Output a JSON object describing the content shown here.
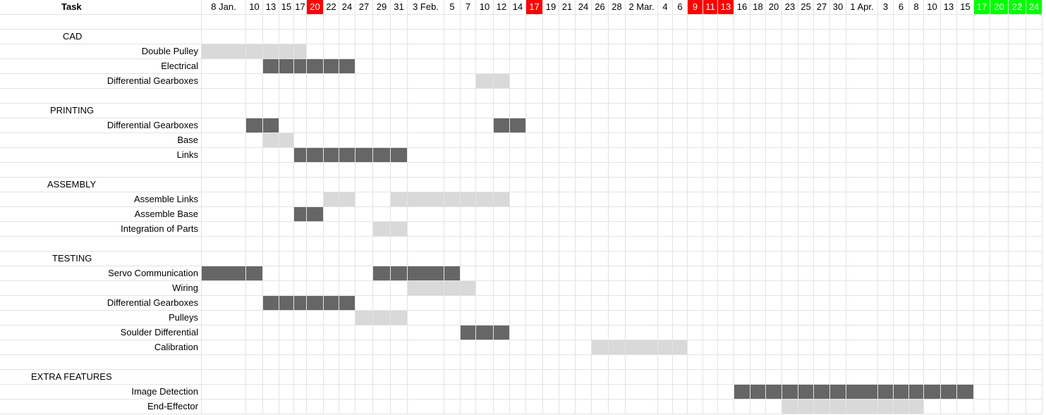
{
  "sheet": {
    "task_header": "Task",
    "dates": [
      "8 Jan.",
      "10",
      "13",
      "15",
      "17",
      "20",
      "22",
      "24",
      "27",
      "29",
      "31",
      "3 Feb.",
      "5",
      "7",
      "10",
      "12",
      "14",
      "17",
      "19",
      "21",
      "24",
      "26",
      "28",
      "2 Mar.",
      "4",
      "6",
      "9",
      "11",
      "13",
      "16",
      "18",
      "20",
      "23",
      "25",
      "27",
      "30",
      "1 Apr.",
      "3",
      "6",
      "8",
      "10",
      "13",
      "15",
      "17",
      "20",
      "22",
      "24"
    ],
    "date_highlights": {
      "5": "red",
      "17": "red",
      "26": "red",
      "27": "red",
      "28": "red",
      "43": "green",
      "44": "green",
      "45": "green",
      "46": "green"
    },
    "highlight_colors": {
      "red": "#ff0000",
      "green": "#00ff00"
    },
    "bar_colors": {
      "dark": "#666666",
      "light": "#d9d9d9"
    },
    "rows": [
      {
        "type": "blank"
      },
      {
        "type": "section",
        "label": "CAD"
      },
      {
        "type": "task",
        "label": "Double Pulley",
        "bars": [
          {
            "start": 0,
            "end": 4,
            "shade": "light"
          }
        ]
      },
      {
        "type": "task",
        "label": "Electrical",
        "bars": [
          {
            "start": 2,
            "end": 7,
            "shade": "dark"
          }
        ]
      },
      {
        "type": "task",
        "label": "Differential Gearboxes",
        "bars": [
          {
            "start": 14,
            "end": 15,
            "shade": "light"
          }
        ]
      },
      {
        "type": "blank"
      },
      {
        "type": "section",
        "label": "PRINTING"
      },
      {
        "type": "task",
        "label": "Differential Gearboxes",
        "bars": [
          {
            "start": 1,
            "end": 2,
            "shade": "dark"
          },
          {
            "start": 15,
            "end": 16,
            "shade": "dark"
          }
        ]
      },
      {
        "type": "task",
        "label": "Base",
        "bars": [
          {
            "start": 2,
            "end": 3,
            "shade": "light"
          }
        ]
      },
      {
        "type": "task",
        "label": "Links",
        "bars": [
          {
            "start": 4,
            "end": 10,
            "shade": "dark"
          }
        ]
      },
      {
        "type": "blank"
      },
      {
        "type": "section",
        "label": "ASSEMBLY"
      },
      {
        "type": "task",
        "label": "Assemble Links",
        "bars": [
          {
            "start": 6,
            "end": 7,
            "shade": "light"
          },
          {
            "start": 10,
            "end": 15,
            "shade": "light"
          }
        ]
      },
      {
        "type": "task",
        "label": "Assemble Base",
        "bars": [
          {
            "start": 4,
            "end": 5,
            "shade": "dark"
          }
        ]
      },
      {
        "type": "task",
        "label": "Integration of Parts",
        "bars": [
          {
            "start": 9,
            "end": 10,
            "shade": "light"
          }
        ]
      },
      {
        "type": "blank"
      },
      {
        "type": "section",
        "label": "TESTING"
      },
      {
        "type": "task",
        "label": "Servo Communication",
        "bars": [
          {
            "start": 0,
            "end": 1,
            "shade": "dark"
          },
          {
            "start": 9,
            "end": 12,
            "shade": "dark"
          }
        ]
      },
      {
        "type": "task",
        "label": "Wiring",
        "bars": [
          {
            "start": 11,
            "end": 13,
            "shade": "light"
          }
        ]
      },
      {
        "type": "task",
        "label": "Differential Gearboxes",
        "bars": [
          {
            "start": 2,
            "end": 7,
            "shade": "dark"
          }
        ]
      },
      {
        "type": "task",
        "label": "Pulleys",
        "bars": [
          {
            "start": 8,
            "end": 10,
            "shade": "light"
          }
        ]
      },
      {
        "type": "task",
        "label": "Soulder Differential",
        "bars": [
          {
            "start": 13,
            "end": 15,
            "shade": "dark"
          }
        ]
      },
      {
        "type": "task",
        "label": "Calibration",
        "bars": [
          {
            "start": 21,
            "end": 25,
            "shade": "light"
          }
        ]
      },
      {
        "type": "blank"
      },
      {
        "type": "section",
        "label": "EXTRA FEATURES"
      },
      {
        "type": "task",
        "label": "Image Detection",
        "bars": [
          {
            "start": 29,
            "end": 42,
            "shade": "dark"
          }
        ]
      },
      {
        "type": "task",
        "label": "End-Effector",
        "bars": [
          {
            "start": 32,
            "end": 39,
            "shade": "light"
          }
        ]
      }
    ]
  }
}
